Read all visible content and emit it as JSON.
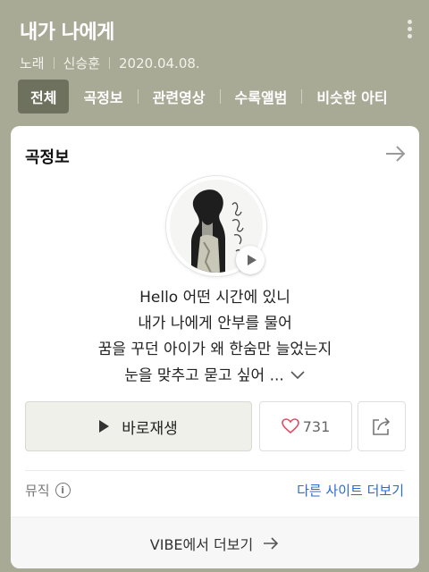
{
  "header": {
    "title": "내가 나에게",
    "meta": [
      "노래",
      "신승훈",
      "2020.04.08."
    ],
    "tabs": [
      {
        "label": "전체",
        "active": true
      },
      {
        "label": "곡정보",
        "active": false
      },
      {
        "label": "관련영상",
        "active": false
      },
      {
        "label": "수록앨범",
        "active": false
      },
      {
        "label": "비슷한 아티",
        "active": false
      }
    ]
  },
  "card": {
    "title": "곡정보",
    "lyrics": [
      "Hello 어떤 시간에 있니",
      "내가 나에게 안부를 물어",
      "꿈을 꾸던 아이가 왜 한숨만 늘었는지",
      "눈을 맞추고 묻고 싶어 ..."
    ],
    "play_button_label": "바로재생",
    "like_count": "731",
    "music_label": "뮤직",
    "more_sites_label": "다른 사이트 더보기",
    "vibe_label": "VIBE에서 더보기"
  },
  "colors": {
    "background": "#a9aa96",
    "active_tab": "#6f715f",
    "link": "#2a6bd1",
    "heart": "#e04b63"
  }
}
